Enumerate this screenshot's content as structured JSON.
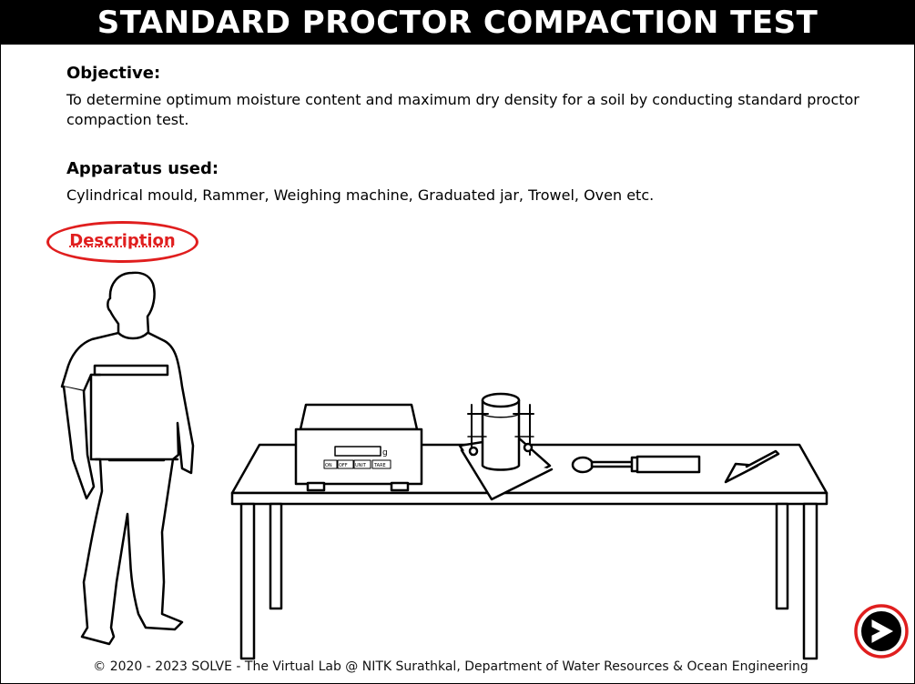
{
  "header": {
    "title": "STANDARD PROCTOR COMPACTION TEST"
  },
  "objective": {
    "heading": "Objective:",
    "text": "To determine optimum moisture content and maximum dry density for a soil by conducting standard proctor compaction test."
  },
  "apparatus": {
    "heading": "Apparatus used:",
    "text": "Cylindrical mould, Rammer, Weighing machine, Graduated jar, Trowel, Oven etc."
  },
  "description_link": "Description",
  "scale": {
    "unit": "g",
    "buttons": [
      "ON",
      "OFF",
      "UNIT",
      "TARE"
    ]
  },
  "footer": "© 2020 - 2023 SOLVE - The Virtual Lab @ NITK Surathkal, Department of Water Resources & Ocean Engineering",
  "colors": {
    "accent": "#e01e1e",
    "title_bg": "#000000"
  },
  "icons": {
    "next": "chevron-right-icon"
  }
}
